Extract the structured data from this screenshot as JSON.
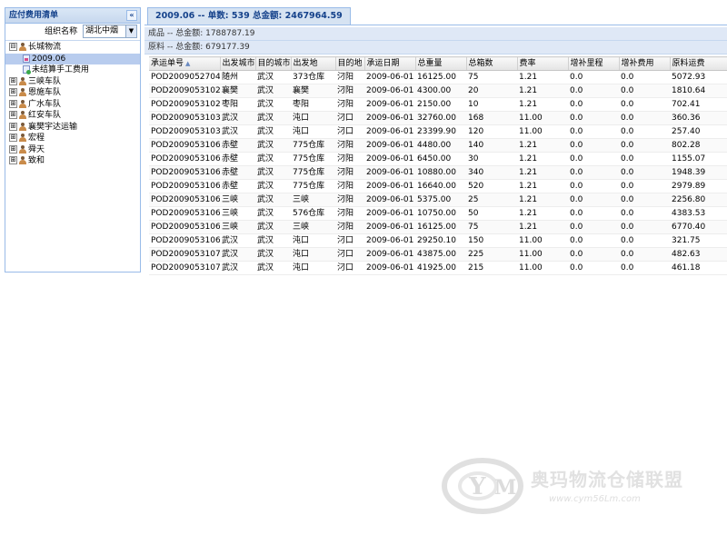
{
  "left_panel": {
    "title": "应付费用清单",
    "collapse_icon": "«",
    "org_label": "组织名称",
    "org_value": "湖北中烟",
    "tree": [
      {
        "label": "长城物流",
        "expand": "⊟",
        "icon": "person",
        "level": 0
      },
      {
        "label": "2009.06",
        "expand": "",
        "icon": "doc-pink",
        "level": 1,
        "selected": true
      },
      {
        "label": "未结算手工费用",
        "expand": "",
        "icon": "doc-green",
        "level": 1
      },
      {
        "label": "三峡车队",
        "expand": "⊞",
        "icon": "person",
        "level": 0
      },
      {
        "label": "恩施车队",
        "expand": "⊞",
        "icon": "person",
        "level": 0
      },
      {
        "label": "广水车队",
        "expand": "⊞",
        "icon": "person",
        "level": 0
      },
      {
        "label": "红安车队",
        "expand": "⊞",
        "icon": "person",
        "level": 0
      },
      {
        "label": "襄樊宇达运输",
        "expand": "⊞",
        "icon": "person",
        "level": 0
      },
      {
        "label": "宏程",
        "expand": "⊞",
        "icon": "person",
        "level": 0
      },
      {
        "label": "舜天",
        "expand": "⊞",
        "icon": "person",
        "level": 0
      },
      {
        "label": "致和",
        "expand": "⊞",
        "icon": "person",
        "level": 0
      }
    ]
  },
  "tab": {
    "label": "2009.06 -- 单数: 539 总金额: 2467964.59"
  },
  "summaries": [
    "成品 -- 总金额: 1788787.19",
    "原料 -- 总金额: 679177.39"
  ],
  "table": {
    "sort_indicator": "▲",
    "columns": [
      "承运单号",
      "出发城市",
      "目的城市",
      "出发地",
      "目的地",
      "承运日期",
      "总重量",
      "总箱数",
      "费率",
      "增补里程",
      "增补费用",
      "原料运费"
    ],
    "rows": [
      [
        "POD20090527045",
        "随州",
        "武汉",
        "373仓库",
        "汈阳",
        "2009-06-01",
        "16125.00",
        "75",
        "1.21",
        "0.0",
        "0.0",
        "5072.93"
      ],
      [
        "POD20090531025",
        "襄樊",
        "武汉",
        "襄樊",
        "汈阳",
        "2009-06-01",
        "4300.00",
        "20",
        "1.21",
        "0.0",
        "0.0",
        "1810.64"
      ],
      [
        "POD20090531026",
        "枣阳",
        "武汉",
        "枣阳",
        "汈阳",
        "2009-06-01",
        "2150.00",
        "10",
        "1.21",
        "0.0",
        "0.0",
        "702.41"
      ],
      [
        "POD20090531034",
        "武汉",
        "武汉",
        "沌口",
        "汈口",
        "2009-06-01",
        "32760.00",
        "168",
        "11.00",
        "0.0",
        "0.0",
        "360.36"
      ],
      [
        "POD20090531035",
        "武汉",
        "武汉",
        "沌口",
        "汈口",
        "2009-06-01",
        "23399.90",
        "120",
        "11.00",
        "0.0",
        "0.0",
        "257.40"
      ],
      [
        "POD20090531061",
        "赤壁",
        "武汉",
        "775仓库",
        "汈阳",
        "2009-06-01",
        "4480.00",
        "140",
        "1.21",
        "0.0",
        "0.0",
        "802.28"
      ],
      [
        "POD20090531062",
        "赤壁",
        "武汉",
        "775仓库",
        "汈阳",
        "2009-06-01",
        "6450.00",
        "30",
        "1.21",
        "0.0",
        "0.0",
        "1155.07"
      ],
      [
        "POD20090531063",
        "赤壁",
        "武汉",
        "775仓库",
        "汈阳",
        "2009-06-01",
        "10880.00",
        "340",
        "1.21",
        "0.0",
        "0.0",
        "1948.39"
      ],
      [
        "POD20090531064",
        "赤壁",
        "武汉",
        "775仓库",
        "汈阳",
        "2009-06-01",
        "16640.00",
        "520",
        "1.21",
        "0.0",
        "0.0",
        "2979.89"
      ],
      [
        "POD20090531065",
        "三峡",
        "武汉",
        "三峡",
        "汈阳",
        "2009-06-01",
        "5375.00",
        "25",
        "1.21",
        "0.0",
        "0.0",
        "2256.80"
      ],
      [
        "POD20090531066",
        "三峡",
        "武汉",
        "576仓库",
        "汈阳",
        "2009-06-01",
        "10750.00",
        "50",
        "1.21",
        "0.0",
        "0.0",
        "4383.53"
      ],
      [
        "POD20090531067",
        "三峡",
        "武汉",
        "三峡",
        "汈阳",
        "2009-06-01",
        "16125.00",
        "75",
        "1.21",
        "0.0",
        "0.0",
        "6770.40"
      ],
      [
        "POD20090531069",
        "武汉",
        "武汉",
        "沌口",
        "汈口",
        "2009-06-01",
        "29250.10",
        "150",
        "11.00",
        "0.0",
        "0.0",
        "321.75"
      ],
      [
        "POD20090531070",
        "武汉",
        "武汉",
        "沌口",
        "汈口",
        "2009-06-01",
        "43875.00",
        "225",
        "11.00",
        "0.0",
        "0.0",
        "482.63"
      ],
      [
        "POD20090531071",
        "武汉",
        "武汉",
        "沌口",
        "汈口",
        "2009-06-01",
        "41925.00",
        "215",
        "11.00",
        "0.0",
        "0.0",
        "461.18"
      ]
    ]
  },
  "watermark": {
    "text": "奥玛物流仓储联盟",
    "url": "www.cym56Lm.com"
  }
}
